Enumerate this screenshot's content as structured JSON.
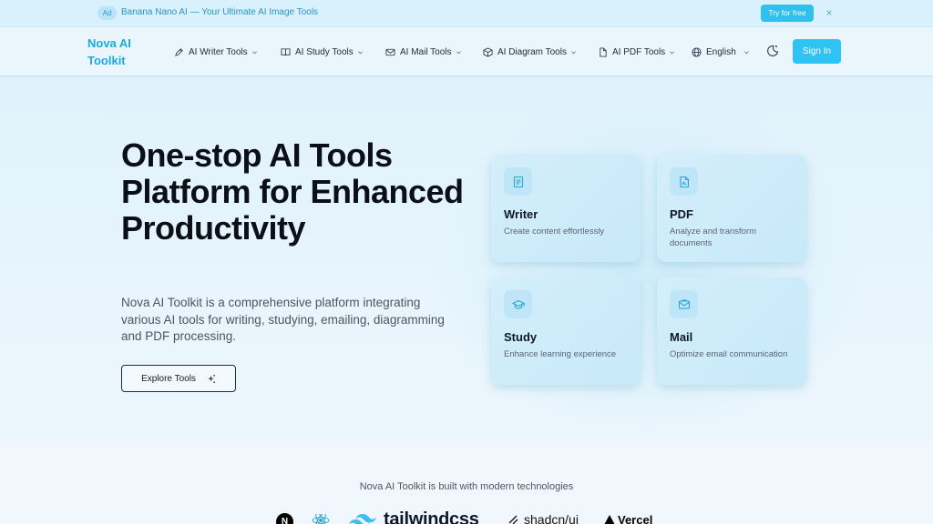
{
  "ad": {
    "badge": "Ad",
    "text": "Banana Nano AI — Your Ultimate AI Image Tools",
    "cta": "Try for free",
    "close": "×"
  },
  "nav": {
    "brand": "Nova AI Toolkit",
    "items": [
      {
        "label": "AI Writer Tools",
        "icon": "pen-icon"
      },
      {
        "label": "AI Study Tools",
        "icon": "book-icon"
      },
      {
        "label": "AI Mail Tools",
        "icon": "mail-icon"
      },
      {
        "label": "AI Diagram Tools",
        "icon": "cube-icon"
      },
      {
        "label": "AI PDF Tools",
        "icon": "file-icon"
      }
    ],
    "language": "English",
    "signin": "Sign In"
  },
  "hero": {
    "title": "One-stop AI Tools Platform for Enhanced Productivity",
    "description": "Nova AI Toolkit is a comprehensive platform integrating various AI tools for writing, studying, emailing, diagramming and PDF processing.",
    "explore_button": "Explore Tools"
  },
  "cards": [
    {
      "title": "Writer",
      "description": "Create content effortlessly",
      "icon": "document-text-icon"
    },
    {
      "title": "PDF",
      "description": "Analyze and transform documents",
      "icon": "pdf-file-icon"
    },
    {
      "title": "Study",
      "description": "Enhance learning experience",
      "icon": "graduation-cap-icon"
    },
    {
      "title": "Mail",
      "description": "Optimize email communication",
      "icon": "mail-open-icon"
    }
  ],
  "built_with": {
    "text": "Nova AI Toolkit is built with modern technologies",
    "logos": [
      {
        "name": "next-logo",
        "label": "N"
      },
      {
        "name": "react-logo",
        "label": ""
      },
      {
        "name": "tailwind-logo",
        "label": "tailwindcss"
      },
      {
        "name": "shadcn-logo",
        "label": "shadcn/ui"
      },
      {
        "name": "vercel-logo",
        "label": "Vercel"
      }
    ]
  },
  "colors": {
    "accent": "#2ec3f2",
    "brand": "#1ba9dd",
    "ad_bar": "#d9f1fc",
    "card": "#cdebfa"
  }
}
